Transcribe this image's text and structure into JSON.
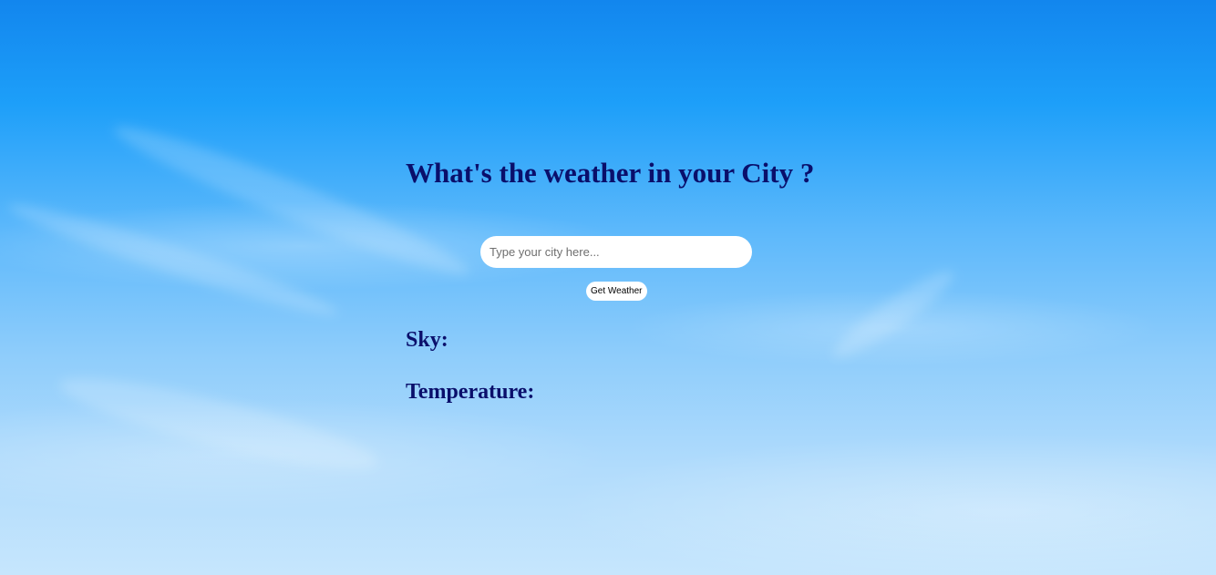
{
  "heading": "What's the weather in your City ?",
  "search": {
    "value": "",
    "placeholder": "Type your city here..."
  },
  "button_label": "Get Weather",
  "results": {
    "sky_label": "Sky:",
    "temperature_label": "Temperature:"
  },
  "colors": {
    "text": "#0a0f6b",
    "sky_top": "#1286ee",
    "sky_bottom": "#c6e6fd",
    "input_bg": "#ffffff"
  }
}
